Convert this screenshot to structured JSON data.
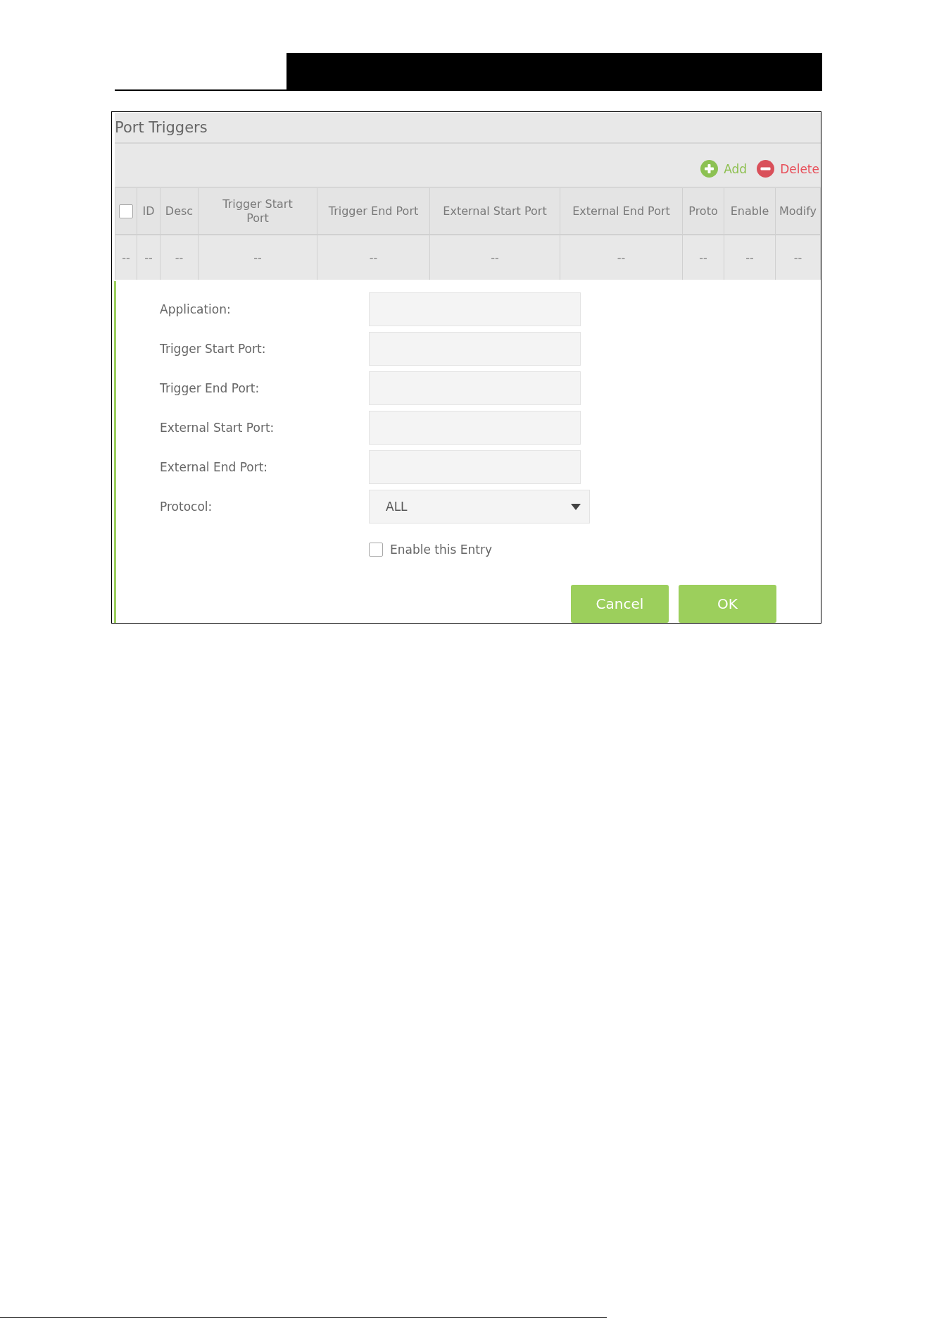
{
  "panel": {
    "title": "Port Triggers"
  },
  "toolbar": {
    "actions": [
      {
        "kind": "add",
        "label": "Add"
      },
      {
        "kind": "delete",
        "label": "Delete"
      }
    ]
  },
  "table": {
    "columns": [
      {
        "kind": "checkbox",
        "checked": false
      },
      {
        "kind": "text",
        "label": "ID"
      },
      {
        "kind": "text",
        "label": "Desc"
      },
      {
        "kind": "text",
        "label": "Trigger Start Port"
      },
      {
        "kind": "text",
        "label": "Trigger End Port"
      },
      {
        "kind": "text",
        "label": "External Start Port"
      },
      {
        "kind": "text",
        "label": "External End Port"
      },
      {
        "kind": "text",
        "label": "Proto"
      },
      {
        "kind": "text",
        "label": "Enable"
      },
      {
        "kind": "text",
        "label": "Modify"
      }
    ],
    "rows": [
      [
        "--",
        "--",
        "--",
        "--",
        "--",
        "--",
        "--",
        "--",
        "--",
        "--"
      ]
    ]
  },
  "form": {
    "fields": [
      {
        "kind": "text",
        "label": "Application:"
      },
      {
        "kind": "text",
        "label": "Trigger Start Port:"
      },
      {
        "kind": "text",
        "label": "Trigger End Port:"
      },
      {
        "kind": "text",
        "label": "External Start Port:"
      },
      {
        "kind": "text",
        "label": "External End Port:"
      },
      {
        "kind": "select",
        "label": "Protocol:",
        "value": "ALL"
      }
    ],
    "enable": {
      "label": "Enable this Entry",
      "checked": false
    },
    "buttons": [
      "Cancel",
      "OK"
    ]
  }
}
